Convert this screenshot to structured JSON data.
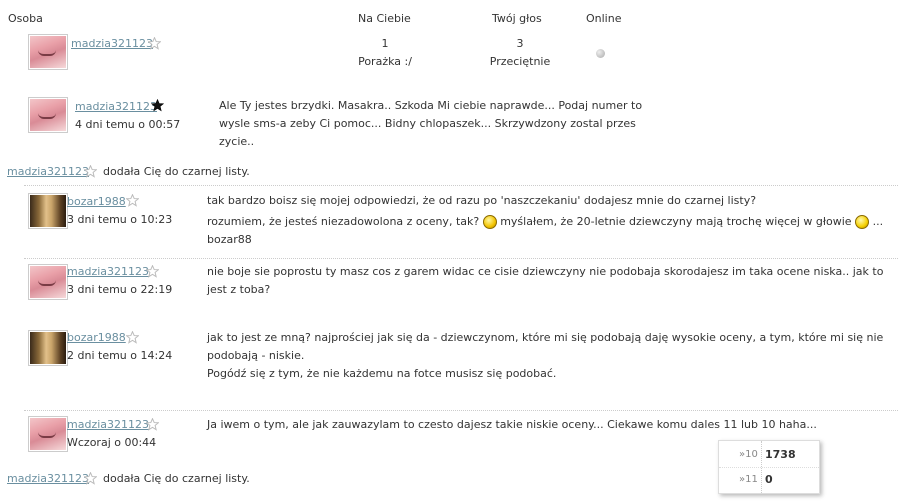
{
  "header": {
    "osoba": "Osoba",
    "na_ciebie": "Na Ciebie",
    "twoj_glos": "Twój głos",
    "online": "Online"
  },
  "profile": {
    "name": "madzia321123",
    "na_ciebie_value": "1",
    "na_ciebie_label": "Porażka :/",
    "twoj_glos_value": "3",
    "twoj_glos_label": "Przeciętnie"
  },
  "messages": [
    {
      "author": "madzia321123",
      "date": "4 dni temu o 00:57",
      "lines": [
        "Ale Ty jestes brzydki. Masakra.. Szkoda Mi ciebie naprawde... Podaj numer to",
        "wysle sms-a zeby Ci pomoc... Bidny chlopaszek... Skrzywdzony zostal przes",
        "zycie.."
      ]
    },
    {
      "author": "bozar1988",
      "date": "3 dni temu o 10:23",
      "line1": "tak bardzo boisz się mojej odpowiedzi, że od razu po 'naszczekaniu' dodajesz mnie do czarnej listy?",
      "line2a": "rozumiem, że jesteś niezadowolona z oceny, tak?",
      "line2b": "myślałem, że 20-letnie dziewczyny mają trochę więcej w głowie",
      "line2c": "...",
      "line3": "bozar88"
    },
    {
      "author": "madzia321123",
      "date": "3 dni temu o 22:19",
      "lines": [
        "nie boje sie poprostu ty masz cos z garem widac ce cisie dziewczyny nie podobaja skorodajesz im taka ocene niska.. jak to",
        "jest z toba?"
      ]
    },
    {
      "author": "bozar1988",
      "date": "2 dni temu o 14:24",
      "lines": [
        "jak to jest ze mną? najprościej jak się da - dziewczynom, które mi się podobają daję wysokie oceny, a tym, które mi się nie",
        "podobają - niskie.",
        "Pogódź się z tym, że nie każdemu na fotce musisz się podobać."
      ]
    },
    {
      "author": "madzia321123",
      "date": "Wczoraj o 00:44",
      "lines": [
        "Ja iwem o tym, ale jak zauwazylam to czesto dajesz takie niskie oceny... Ciekawe komu dales 11 lub 10 haha..."
      ]
    }
  ],
  "blacklist_notes": [
    {
      "name": "madzia321123",
      "text": "dodała Cię do czarnej listy."
    },
    {
      "name": "madzia321123",
      "text": "dodała Cię do czarnej listy."
    }
  ],
  "popup": {
    "rows": [
      {
        "key": "»10",
        "value": "1738"
      },
      {
        "key": "»11",
        "value": "0"
      }
    ]
  }
}
